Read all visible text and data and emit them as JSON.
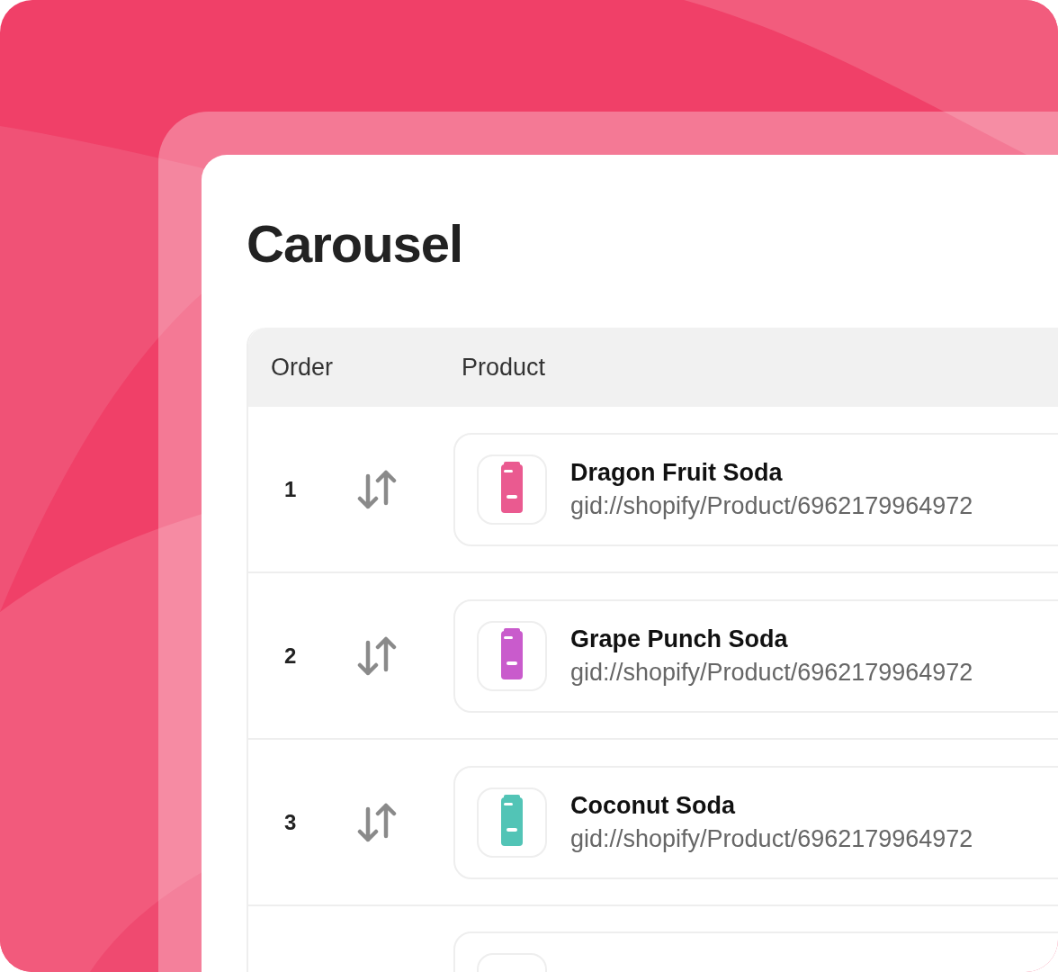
{
  "title": "Carousel",
  "table": {
    "columns": [
      "Order",
      "Product"
    ],
    "rows": [
      {
        "order": "1",
        "name": "Dragon Fruit Soda",
        "id": "gid://shopify/Product/6962179964972",
        "color": "#ea5a90"
      },
      {
        "order": "2",
        "name": "Grape Punch Soda",
        "id": "gid://shopify/Product/6962179964972",
        "color": "#c95bcc"
      },
      {
        "order": "3",
        "name": "Coconut Soda",
        "id": "gid://shopify/Product/6962179964972",
        "color": "#52c4b6"
      },
      {}
    ]
  }
}
